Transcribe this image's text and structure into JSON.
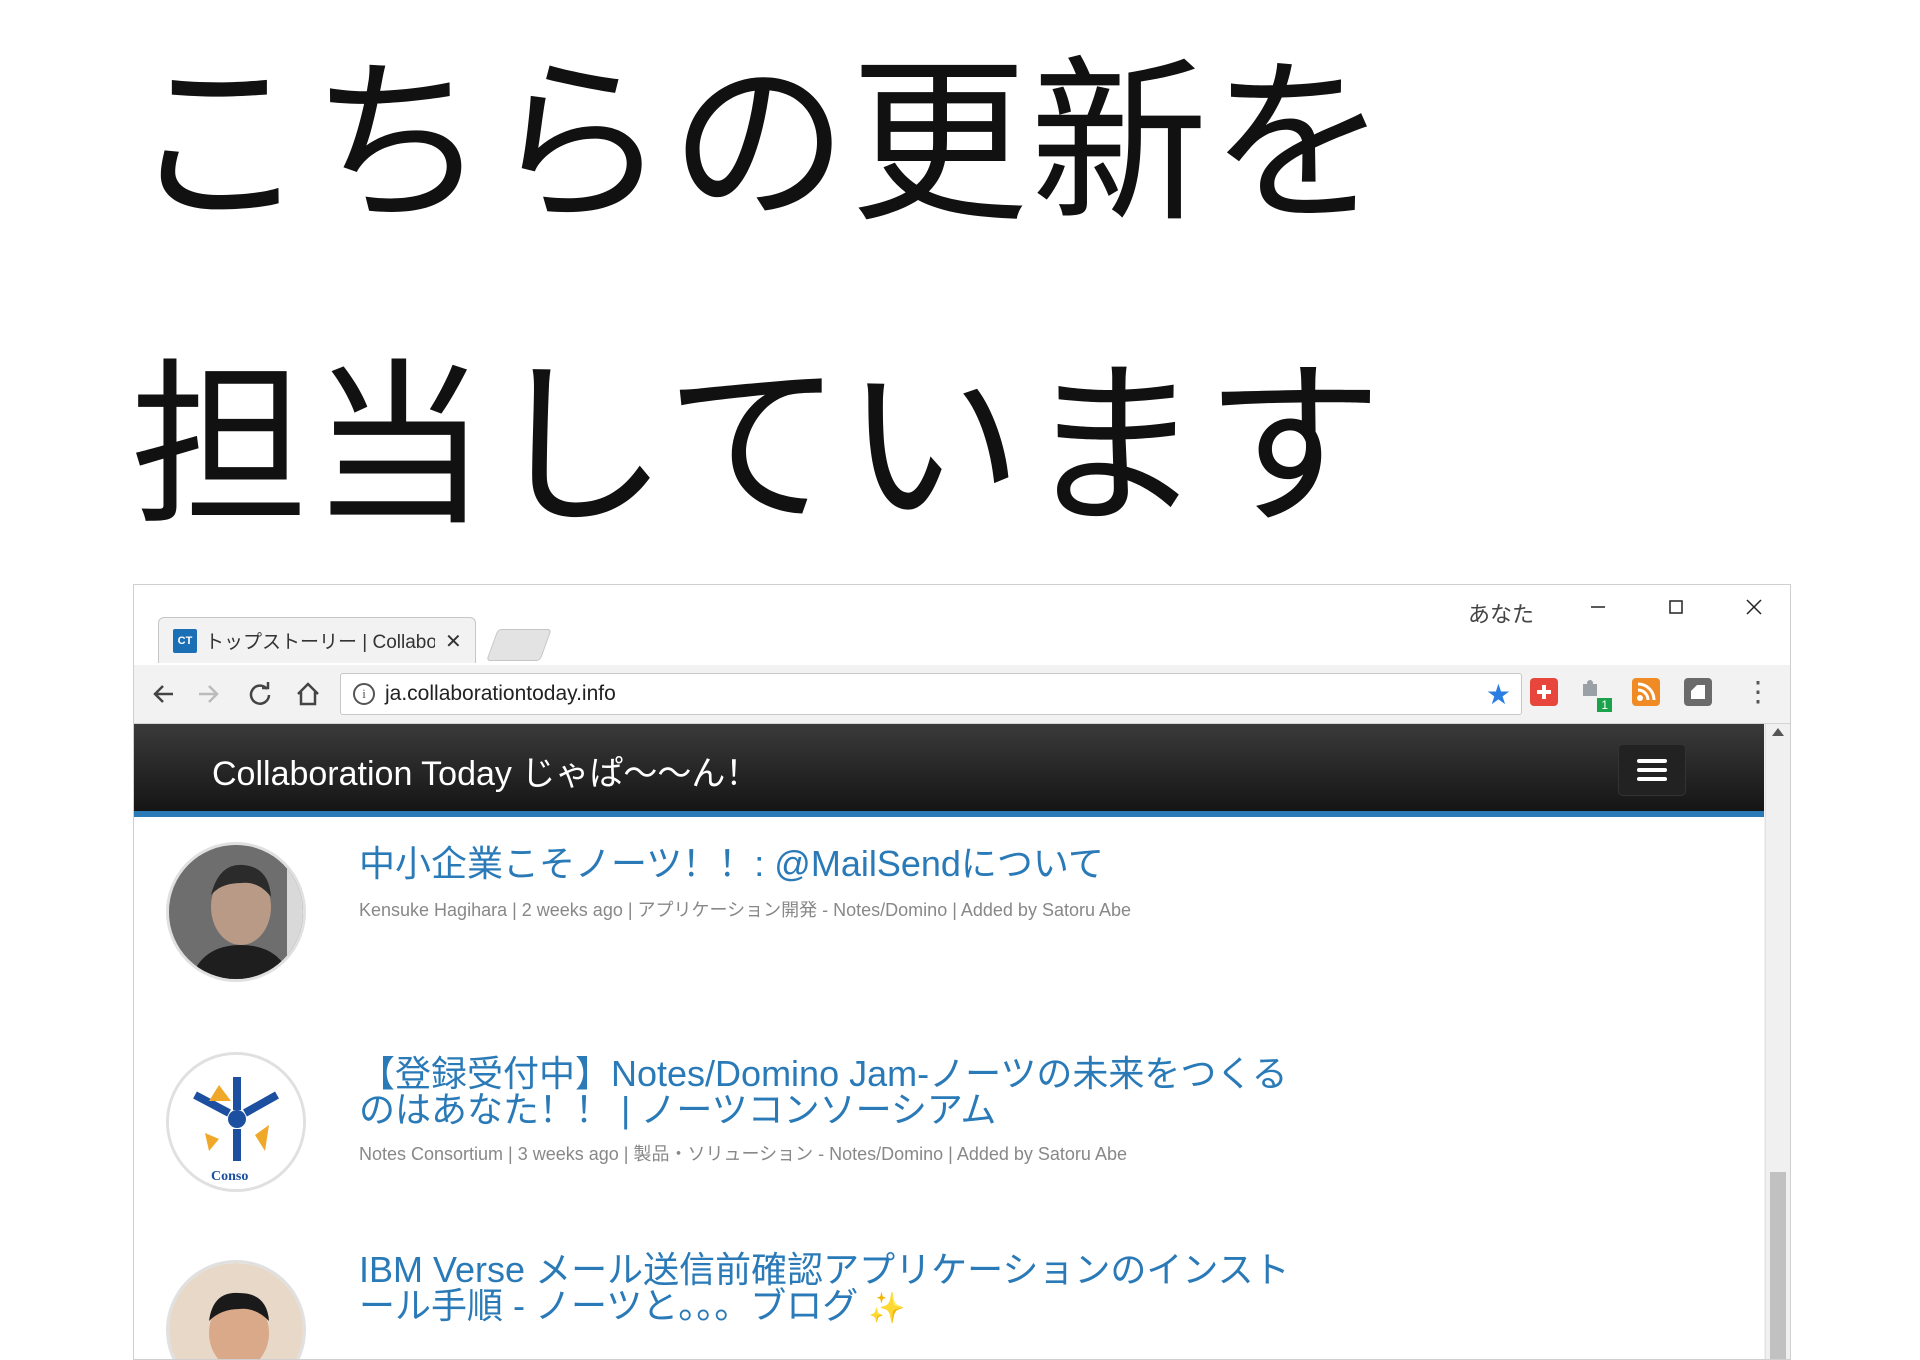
{
  "headline": {
    "line1": "こちらの更新を",
    "line2": "担当しています"
  },
  "browser": {
    "tab": {
      "favicon": "CT",
      "title": "トップストーリー | Collaborat",
      "close": "✕"
    },
    "profile_label": "あなた",
    "window_controls": [
      "minimize-icon",
      "maximize-icon",
      "close-icon"
    ],
    "address": "ja.collaborationtoday.info",
    "extensions": [
      {
        "name": "plus-extension-icon",
        "color": "#e8453c"
      },
      {
        "name": "puzzle-extension-icon",
        "color": "#9aa0a6",
        "badge": "1"
      },
      {
        "name": "rss-extension-icon",
        "color": "#f08a24"
      },
      {
        "name": "evernote-extension-icon",
        "color": "#6b6b6b"
      }
    ]
  },
  "site": {
    "brand": "Collaboration Today じゃぱ〜〜ん！",
    "accent": "#2a7ab8",
    "posts": [
      {
        "title": "中小企業こそノーツ！！: @MailSendについて",
        "meta": "Kensuke Hagihara | 2 weeks ago | アプリケーション開発 - Notes/Domino | Added by Satoru Abe"
      },
      {
        "title": "【登録受付中】Notes/Domino Jam-ノーツの未来をつくるのはあなた！！ | ノーツコンソーシアム",
        "meta": "Notes Consortium | 3 weeks ago | 製品・ソリューション - Notes/Domino | Added by Satoru Abe",
        "logo_text": "Conso"
      },
      {
        "title": "IBM Verse メール送信前確認アプリケーションのインストール手順 - ノーツと。。。ブログ"
      }
    ]
  }
}
